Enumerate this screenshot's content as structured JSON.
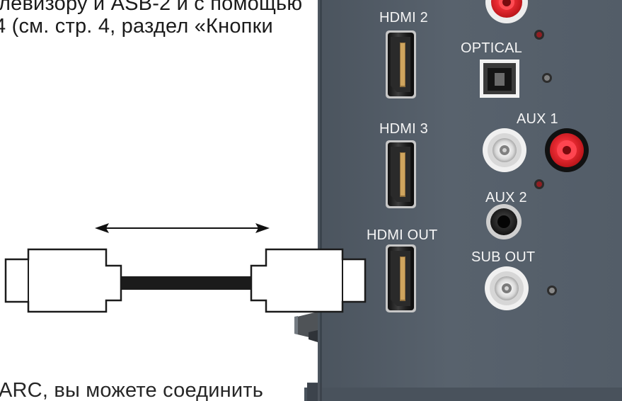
{
  "document": {
    "line1": "левизору и ASB-2 и с помощью",
    "line2": "4 (см. стр. 4, раздел «Кнопки",
    "line3": "ARC, вы можете соединить"
  },
  "panel": {
    "labels": {
      "hdmi2": "HDMI 2",
      "optical": "OPTICAL",
      "hdmi3": "HDMI 3",
      "aux1": "AUX 1",
      "aux2": "AUX 2",
      "hdmi_out": "HDMI OUT",
      "sub_out": "SUB OUT"
    },
    "colors": {
      "panel": "#4b5560",
      "panel_dark": "#3f4852",
      "rca_red": "#e0202a",
      "rca_white": "#f2f2f2",
      "led": "#8f1e22",
      "cable": "#1b1b1b",
      "connector": "#ffffff"
    },
    "icons": [
      "hdmi-port-icon",
      "optical-port-icon",
      "rca-jack-icon",
      "mini-jack-icon",
      "led-icon",
      "hdmi-cable-icon",
      "double-arrow-icon"
    ]
  }
}
